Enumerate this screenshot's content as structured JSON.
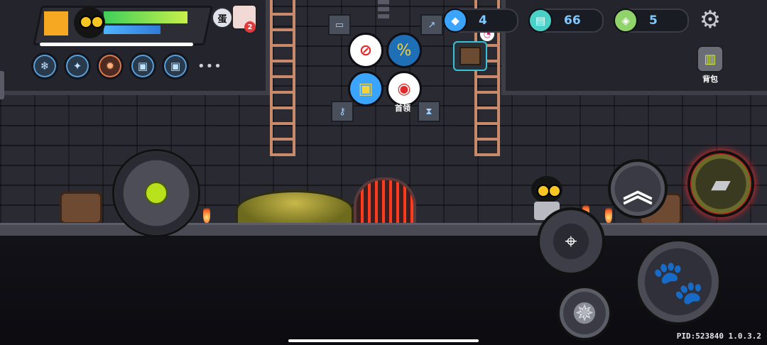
{
  "hud": {
    "health_fraction": 0.72,
    "shield_fraction": 0.6,
    "experience_fraction": 1.0,
    "pet": {
      "chip_text": "蛋",
      "badge_count": "2"
    },
    "buffs": [
      {
        "icon": "frost-buff-icon",
        "glyph": "❄"
      },
      {
        "icon": "spirit-buff-icon",
        "glyph": "✦"
      },
      {
        "icon": "fire-buff-icon",
        "glyph": "✹"
      },
      {
        "icon": "chip-buff-icon",
        "glyph": "▣"
      },
      {
        "icon": "chip-buff-icon",
        "glyph": "▣"
      }
    ],
    "more_buffs": "•••"
  },
  "item_menu": {
    "boss_label": "首领"
  },
  "currencies": [
    {
      "icon": "diamond-icon",
      "value": "4",
      "color": "#3aa4ff"
    },
    {
      "icon": "ticket-icon",
      "value": "66",
      "color": "#4ad0c6"
    },
    {
      "icon": "gem-icon",
      "value": "5",
      "color": "#8fd36a"
    }
  ],
  "backpack": {
    "label": "背包"
  },
  "footer": {
    "pid": "PID:523840 1.0.3.2"
  }
}
